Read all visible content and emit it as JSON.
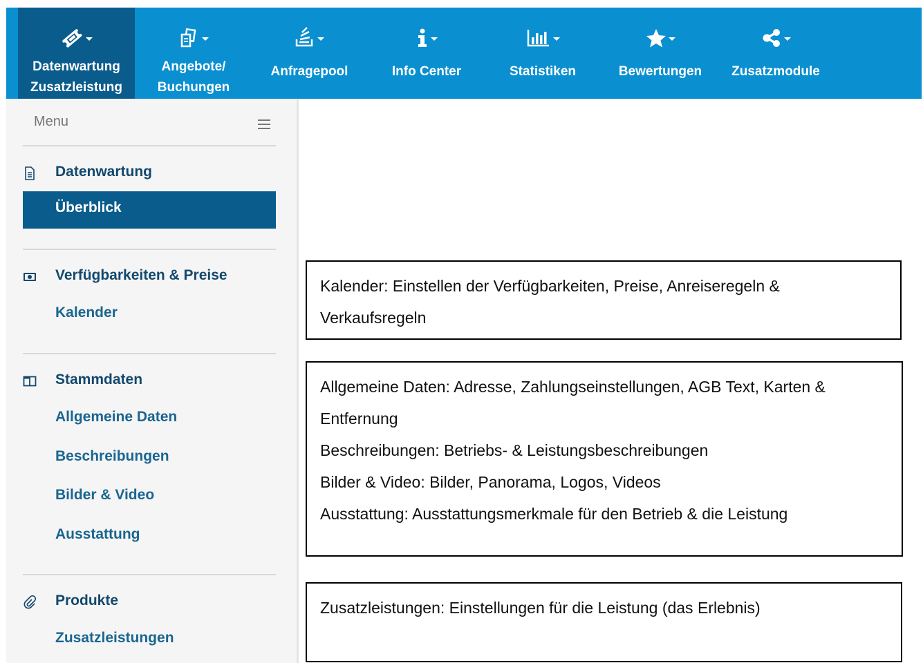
{
  "nav": {
    "items": [
      {
        "line1": "Datenwartung",
        "line2": "Zusatzleistung",
        "icon": "ticket-icon",
        "active": true
      },
      {
        "line1": "Angebote/",
        "line2": "Buchungen",
        "icon": "documents-icon"
      },
      {
        "line1": "Anfragepool",
        "icon": "stack-icon"
      },
      {
        "line1": "Info Center",
        "icon": "info-icon"
      },
      {
        "line1": "Statistiken",
        "icon": "bar-chart-icon"
      },
      {
        "line1": "Bewertungen",
        "icon": "star-icon"
      },
      {
        "line1": "Zusatzmodule",
        "icon": "share-icon"
      }
    ]
  },
  "sidebar": {
    "menu_label": "Menu",
    "sections": [
      {
        "title": "Datenwartung",
        "icon": "document-icon",
        "links": [
          "Überblick"
        ]
      },
      {
        "title": "Verfügbarkeiten & Preise",
        "icon": "money-icon",
        "links": [
          "Kalender"
        ]
      },
      {
        "title": "Stammdaten",
        "icon": "columns-icon",
        "links": [
          "Allgemeine Daten",
          "Beschreibungen",
          "Bilder & Video",
          "Ausstattung"
        ]
      },
      {
        "title": "Produkte",
        "icon": "paperclip-icon",
        "links": [
          "Zusatzleistungen"
        ]
      }
    ]
  },
  "info_boxes": {
    "kalender": [
      "Kalender: Einstellen der Verfügbarkeiten, Preise, Anreiseregeln &",
      "Verkaufsregeln"
    ],
    "stammdaten": [
      "Allgemeine Daten: Adresse, Zahlungseinstellungen, AGB Text, Karten &",
      "Entfernung",
      "Beschreibungen: Betriebs- & Leistungsbeschreibungen",
      "Bilder & Video: Bilder, Panorama, Logos, Videos",
      "Ausstattung: Ausstattungsmerkmale für den Betrieb & die Leistung"
    ],
    "produkte": [
      "Zusatzleistungen: Einstellungen für die Leistung (das Erlebnis)"
    ]
  },
  "colors": {
    "topbar": "#0a8fd1",
    "active": "#0a5c8c",
    "link": "#1a6590",
    "section_title": "#13486d"
  }
}
